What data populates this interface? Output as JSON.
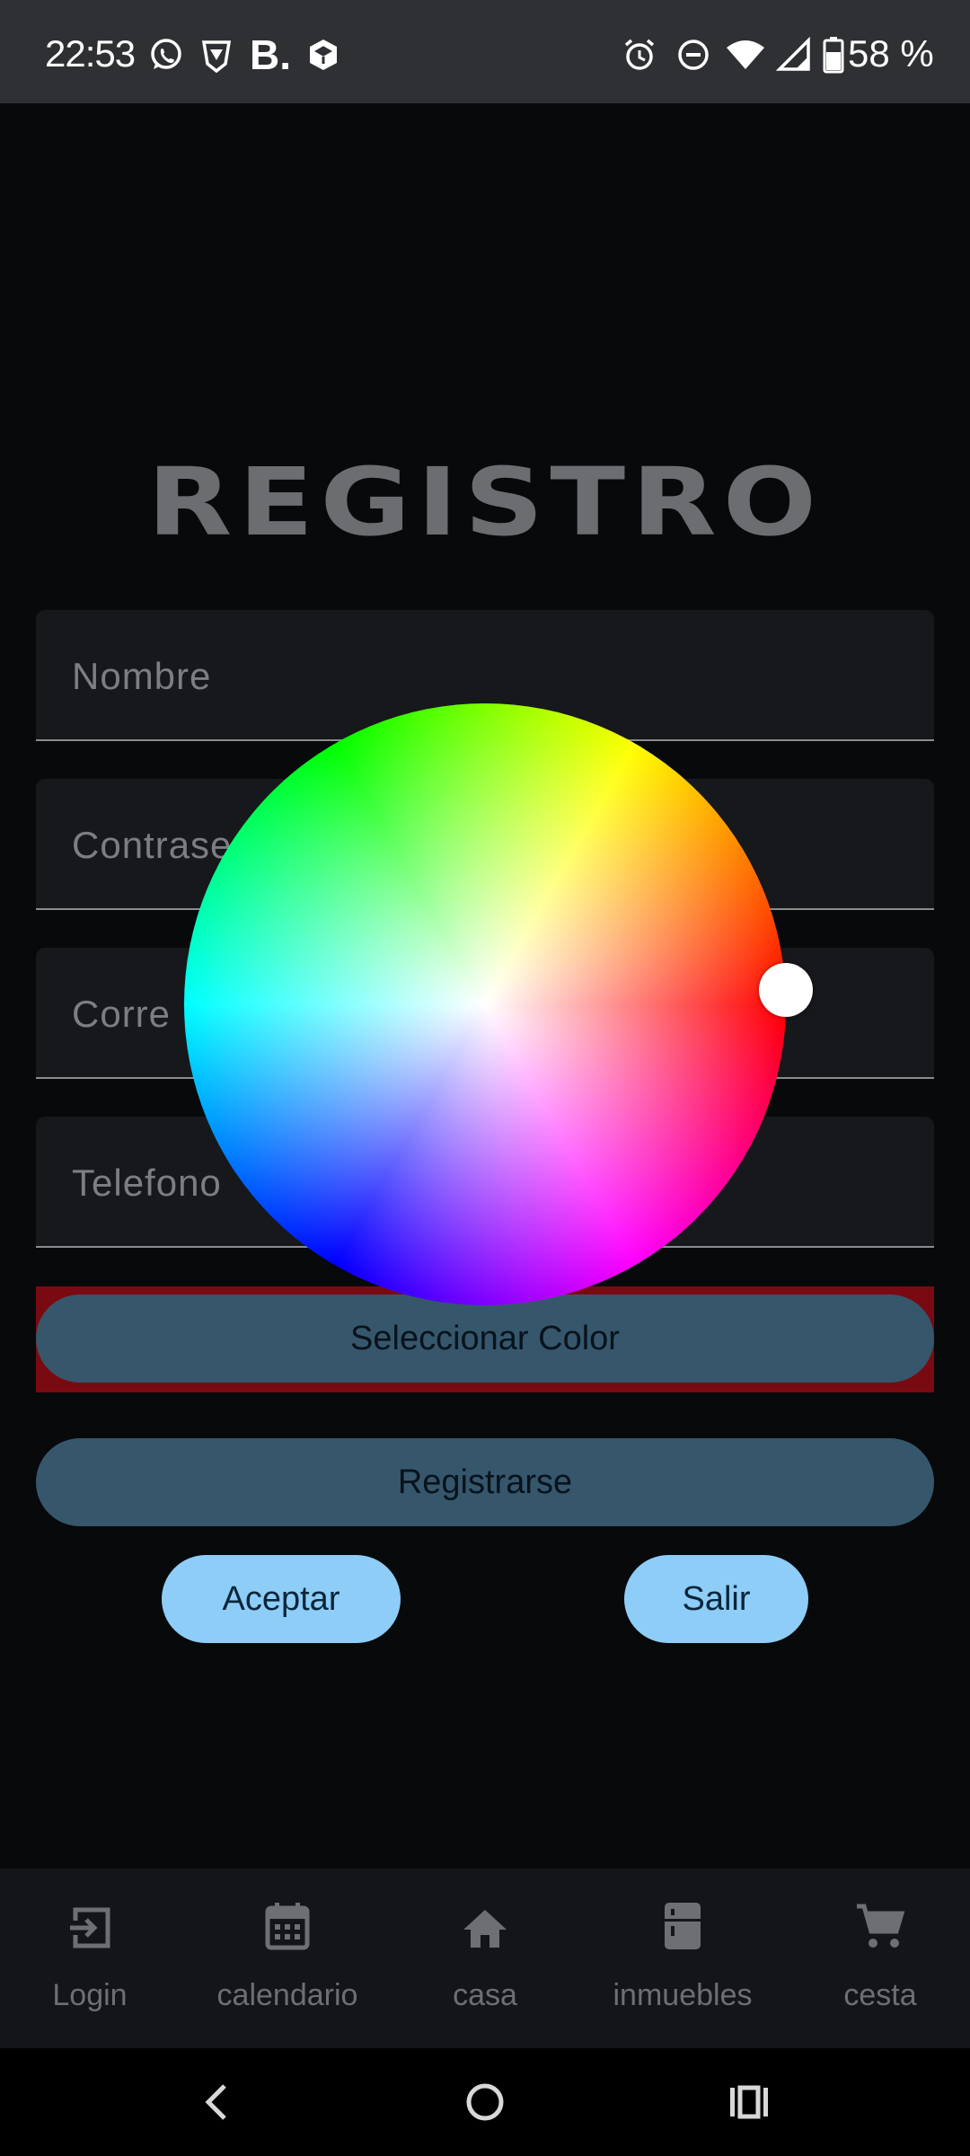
{
  "status_bar": {
    "time": "22:53",
    "battery": "58 %",
    "left_icons": [
      "whatsapp-icon",
      "brave-icon",
      "b-icon",
      "tidal-icon"
    ],
    "right_icons": [
      "alarm-icon",
      "dnd-icon",
      "wifi-icon",
      "signal-icon",
      "battery-icon"
    ]
  },
  "title": "REGISTRO",
  "fields": {
    "nombre": "Nombre",
    "contrasena": "Contrase",
    "correo": "Corre",
    "telefono": "Telefono"
  },
  "buttons": {
    "select_color": "Seleccionar Color",
    "register": "Registrarse",
    "accept": "Aceptar",
    "exit": "Salir"
  },
  "nav": [
    {
      "label": "Login",
      "icon": "login-icon"
    },
    {
      "label": "calendario",
      "icon": "calendar-icon"
    },
    {
      "label": "casa",
      "icon": "home-icon"
    },
    {
      "label": "inmuebles",
      "icon": "fridge-icon"
    },
    {
      "label": "cesta",
      "icon": "cart-icon"
    }
  ],
  "colors": {
    "background": "#08090b",
    "button": "#36566b",
    "button_light": "#8dcdf7",
    "highlight": "#7a0a12",
    "nav_text": "#6d6f73"
  }
}
